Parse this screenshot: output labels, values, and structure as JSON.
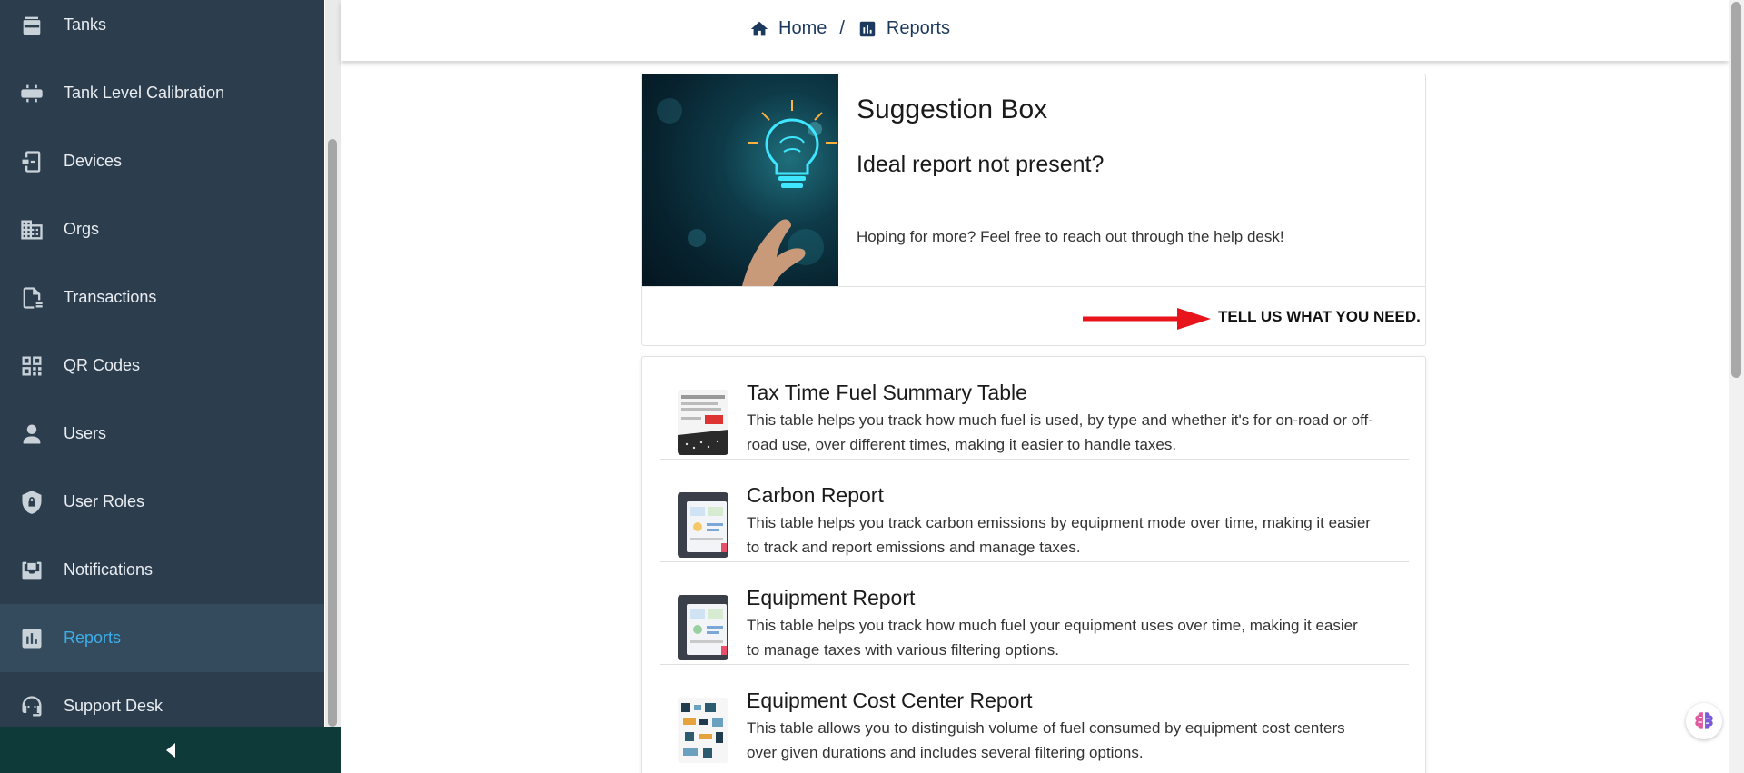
{
  "sidebar": {
    "items": [
      {
        "label": "Tanks",
        "icon": "tank-icon"
      },
      {
        "label": "Tank Level Calibration",
        "icon": "calibration-icon"
      },
      {
        "label": "Devices",
        "icon": "device-icon"
      },
      {
        "label": "Orgs",
        "icon": "building-icon"
      },
      {
        "label": "Transactions",
        "icon": "receipt-icon"
      },
      {
        "label": "QR Codes",
        "icon": "qr-code-icon"
      },
      {
        "label": "Users",
        "icon": "user-icon"
      },
      {
        "label": "User Roles",
        "icon": "shield-lock-icon"
      },
      {
        "label": "Notifications",
        "icon": "inbox-icon"
      },
      {
        "label": "Reports",
        "icon": "bar-chart-icon",
        "active": true
      },
      {
        "label": "Support Desk",
        "icon": "support-agent-icon"
      }
    ]
  },
  "breadcrumb": {
    "home": "Home",
    "separator": "/",
    "current": "Reports"
  },
  "suggestion": {
    "title": "Suggestion Box",
    "subtitle": "Ideal report not present?",
    "text": "Hoping for more? Feel free to reach out through the help desk!",
    "action": "TELL US WHAT YOU NEED."
  },
  "reports": [
    {
      "title": "Tax Time Fuel Summary Table",
      "description": "This table helps you track how much fuel is used, by type and whether it's for on-road or off-road use, over different times, making it easier to handle taxes."
    },
    {
      "title": "Carbon Report",
      "description": "This table helps you track carbon emissions by equipment mode over time, making it easier to track and report emissions and manage taxes."
    },
    {
      "title": "Equipment Report",
      "description": "This table helps you track how much fuel your equipment uses over time, making it easier to manage taxes with various filtering options."
    },
    {
      "title": "Equipment Cost Center Report",
      "description": "This table allows you to distinguish volume of fuel consumed by equipment cost centers over given durations and includes several filtering options."
    }
  ],
  "colors": {
    "sidebar_bg": "#2c3e4e",
    "active_text": "#3daee9",
    "collapse_bar": "#0f3a3a",
    "breadcrumb": "#1c3a5e",
    "arrow": "#e8141b"
  }
}
